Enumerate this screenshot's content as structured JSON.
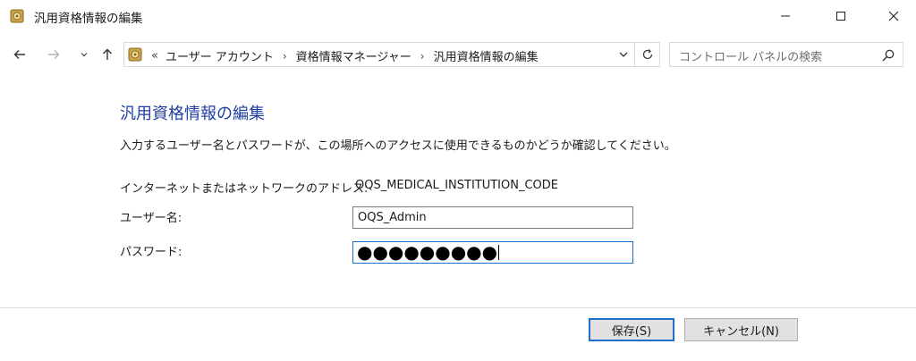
{
  "window": {
    "title": "汎用資格情報の編集"
  },
  "navigation": {
    "back_icon": "arrow-left-icon",
    "forward_icon": "arrow-right-icon",
    "recent_icon": "chevron-down-icon",
    "up_icon": "arrow-up-icon",
    "breadcrumb_overflow": "«",
    "breadcrumbs": [
      "ユーザー アカウント",
      "資格情報マネージャー",
      "汎用資格情報の編集"
    ],
    "breadcrumb_separator": "›",
    "search_placeholder": "コントロール パネルの検索"
  },
  "content": {
    "heading": "汎用資格情報の編集",
    "description": "入力するユーザー名とパスワードが、この場所へのアクセスに使用できるものかどうか確認してください。",
    "address_label": "インターネットまたはネットワークのアドレス:",
    "address_value": "OQS_MEDICAL_INSTITUTION_CODE",
    "username_label": "ユーザー名:",
    "username_value": "OQS_Admin",
    "password_label": "パスワード:",
    "password_mask": "●●●●●●●●●"
  },
  "buttons": {
    "save": "保存(S)",
    "cancel": "キャンセル(N)"
  },
  "colors": {
    "heading": "#1e3fa0",
    "focus_border": "#1e6fd0",
    "button_face": "#e1e1e1"
  }
}
